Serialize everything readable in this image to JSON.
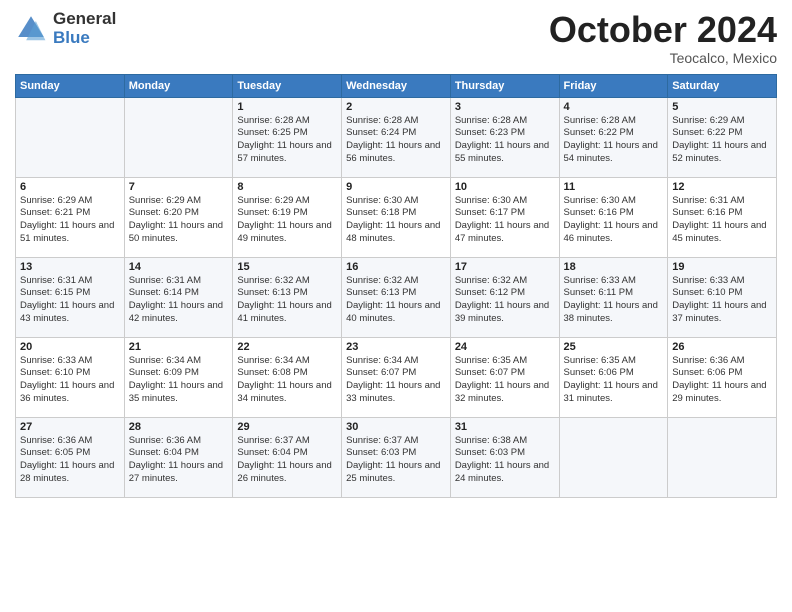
{
  "header": {
    "logo_general": "General",
    "logo_blue": "Blue",
    "month": "October 2024",
    "location": "Teocalco, Mexico"
  },
  "weekdays": [
    "Sunday",
    "Monday",
    "Tuesday",
    "Wednesday",
    "Thursday",
    "Friday",
    "Saturday"
  ],
  "weeks": [
    [
      {
        "day": "",
        "info": ""
      },
      {
        "day": "",
        "info": ""
      },
      {
        "day": "1",
        "info": "Sunrise: 6:28 AM\nSunset: 6:25 PM\nDaylight: 11 hours and 57 minutes."
      },
      {
        "day": "2",
        "info": "Sunrise: 6:28 AM\nSunset: 6:24 PM\nDaylight: 11 hours and 56 minutes."
      },
      {
        "day": "3",
        "info": "Sunrise: 6:28 AM\nSunset: 6:23 PM\nDaylight: 11 hours and 55 minutes."
      },
      {
        "day": "4",
        "info": "Sunrise: 6:28 AM\nSunset: 6:22 PM\nDaylight: 11 hours and 54 minutes."
      },
      {
        "day": "5",
        "info": "Sunrise: 6:29 AM\nSunset: 6:22 PM\nDaylight: 11 hours and 52 minutes."
      }
    ],
    [
      {
        "day": "6",
        "info": "Sunrise: 6:29 AM\nSunset: 6:21 PM\nDaylight: 11 hours and 51 minutes."
      },
      {
        "day": "7",
        "info": "Sunrise: 6:29 AM\nSunset: 6:20 PM\nDaylight: 11 hours and 50 minutes."
      },
      {
        "day": "8",
        "info": "Sunrise: 6:29 AM\nSunset: 6:19 PM\nDaylight: 11 hours and 49 minutes."
      },
      {
        "day": "9",
        "info": "Sunrise: 6:30 AM\nSunset: 6:18 PM\nDaylight: 11 hours and 48 minutes."
      },
      {
        "day": "10",
        "info": "Sunrise: 6:30 AM\nSunset: 6:17 PM\nDaylight: 11 hours and 47 minutes."
      },
      {
        "day": "11",
        "info": "Sunrise: 6:30 AM\nSunset: 6:16 PM\nDaylight: 11 hours and 46 minutes."
      },
      {
        "day": "12",
        "info": "Sunrise: 6:31 AM\nSunset: 6:16 PM\nDaylight: 11 hours and 45 minutes."
      }
    ],
    [
      {
        "day": "13",
        "info": "Sunrise: 6:31 AM\nSunset: 6:15 PM\nDaylight: 11 hours and 43 minutes."
      },
      {
        "day": "14",
        "info": "Sunrise: 6:31 AM\nSunset: 6:14 PM\nDaylight: 11 hours and 42 minutes."
      },
      {
        "day": "15",
        "info": "Sunrise: 6:32 AM\nSunset: 6:13 PM\nDaylight: 11 hours and 41 minutes."
      },
      {
        "day": "16",
        "info": "Sunrise: 6:32 AM\nSunset: 6:13 PM\nDaylight: 11 hours and 40 minutes."
      },
      {
        "day": "17",
        "info": "Sunrise: 6:32 AM\nSunset: 6:12 PM\nDaylight: 11 hours and 39 minutes."
      },
      {
        "day": "18",
        "info": "Sunrise: 6:33 AM\nSunset: 6:11 PM\nDaylight: 11 hours and 38 minutes."
      },
      {
        "day": "19",
        "info": "Sunrise: 6:33 AM\nSunset: 6:10 PM\nDaylight: 11 hours and 37 minutes."
      }
    ],
    [
      {
        "day": "20",
        "info": "Sunrise: 6:33 AM\nSunset: 6:10 PM\nDaylight: 11 hours and 36 minutes."
      },
      {
        "day": "21",
        "info": "Sunrise: 6:34 AM\nSunset: 6:09 PM\nDaylight: 11 hours and 35 minutes."
      },
      {
        "day": "22",
        "info": "Sunrise: 6:34 AM\nSunset: 6:08 PM\nDaylight: 11 hours and 34 minutes."
      },
      {
        "day": "23",
        "info": "Sunrise: 6:34 AM\nSunset: 6:07 PM\nDaylight: 11 hours and 33 minutes."
      },
      {
        "day": "24",
        "info": "Sunrise: 6:35 AM\nSunset: 6:07 PM\nDaylight: 11 hours and 32 minutes."
      },
      {
        "day": "25",
        "info": "Sunrise: 6:35 AM\nSunset: 6:06 PM\nDaylight: 11 hours and 31 minutes."
      },
      {
        "day": "26",
        "info": "Sunrise: 6:36 AM\nSunset: 6:06 PM\nDaylight: 11 hours and 29 minutes."
      }
    ],
    [
      {
        "day": "27",
        "info": "Sunrise: 6:36 AM\nSunset: 6:05 PM\nDaylight: 11 hours and 28 minutes."
      },
      {
        "day": "28",
        "info": "Sunrise: 6:36 AM\nSunset: 6:04 PM\nDaylight: 11 hours and 27 minutes."
      },
      {
        "day": "29",
        "info": "Sunrise: 6:37 AM\nSunset: 6:04 PM\nDaylight: 11 hours and 26 minutes."
      },
      {
        "day": "30",
        "info": "Sunrise: 6:37 AM\nSunset: 6:03 PM\nDaylight: 11 hours and 25 minutes."
      },
      {
        "day": "31",
        "info": "Sunrise: 6:38 AM\nSunset: 6:03 PM\nDaylight: 11 hours and 24 minutes."
      },
      {
        "day": "",
        "info": ""
      },
      {
        "day": "",
        "info": ""
      }
    ]
  ]
}
